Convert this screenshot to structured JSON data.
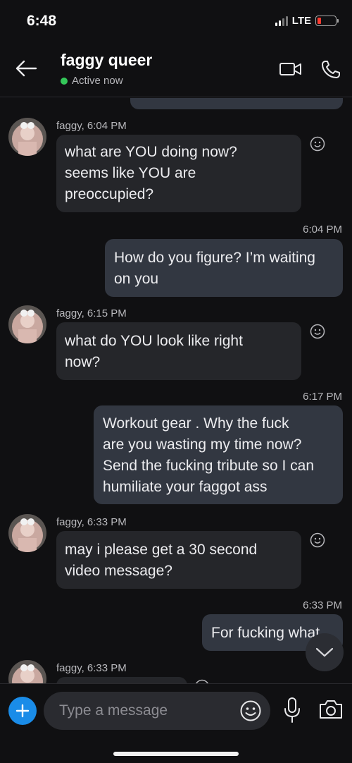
{
  "status_bar": {
    "time": "6:48",
    "network": "LTE"
  },
  "header": {
    "title": "faggy queer",
    "presence": "Active now",
    "colors": {
      "presence_dot": "#34c759"
    }
  },
  "messages": [
    {
      "type": "incoming",
      "sender": "faggy, 6:04 PM",
      "text_lines": [
        "what are YOU doing now?",
        "seems like YOU are",
        "preoccupied?"
      ]
    },
    {
      "type": "outgoing",
      "time": "6:04 PM",
      "text_lines": [
        "How do you figure? I’m waiting",
        "on you"
      ]
    },
    {
      "type": "incoming",
      "sender": "faggy, 6:15 PM",
      "text_lines": [
        "what do YOU look like right",
        "now?"
      ]
    },
    {
      "type": "outgoing",
      "time": "6:17 PM",
      "text_lines": [
        "Workout gear .  Why the fuck",
        "are you wasting my time now?",
        "Send the fucking tribute so I can",
        "humiliate your faggot ass"
      ]
    },
    {
      "type": "incoming",
      "sender": "faggy, 6:33 PM",
      "text_lines": [
        "may i please get a 30 second",
        "video message?"
      ]
    },
    {
      "type": "outgoing",
      "time": "6:33 PM",
      "text_lines": [
        "For fucking what"
      ]
    },
    {
      "type": "incoming",
      "sender": "faggy, 6:33 PM",
      "text_lines": []
    }
  ],
  "composer": {
    "placeholder": "Type a message"
  },
  "icons": [
    "back-arrow-icon",
    "video-call-icon",
    "phone-icon",
    "smiley-icon",
    "chevron-down-icon",
    "plus-icon",
    "microphone-icon",
    "camera-icon"
  ],
  "colors": {
    "background": "#101012",
    "incoming_bubble": "#25262a",
    "outgoing_bubble": "#323741",
    "accent": "#1a8ce8",
    "battery_low": "#ff3b30"
  }
}
